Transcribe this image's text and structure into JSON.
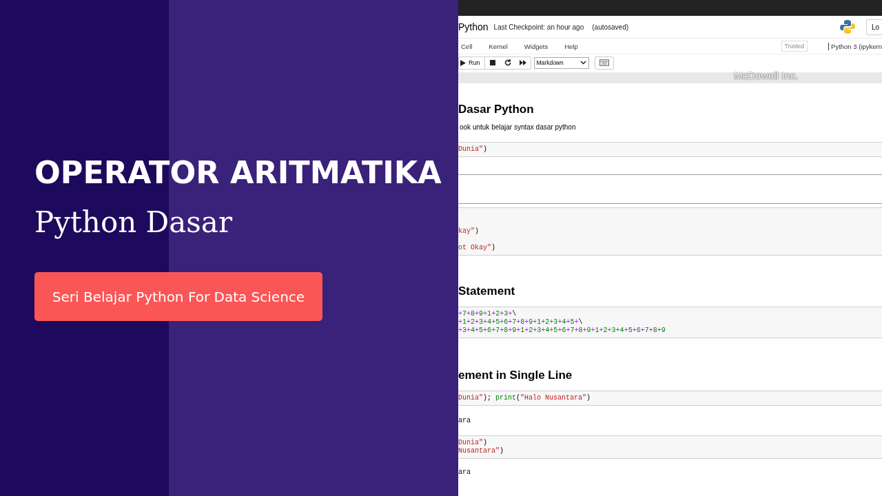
{
  "header": {
    "title": "Python",
    "checkpoint": "Last Checkpoint: an hour ago",
    "autosave": "(autosaved)",
    "login_button": "Lo"
  },
  "menu": [
    "Cell",
    "Kernel",
    "Widgets",
    "Help"
  ],
  "trusted": "Trusted",
  "kernel": "Python 3 (ipykern",
  "toolbar": {
    "run": "Run",
    "cell_type": "Markdown"
  },
  "brand_text": "McDowell Inc.",
  "cells": [
    {
      "kind": "heading",
      "selected": false,
      "text": "Dasar Python"
    },
    {
      "kind": "text",
      "selected": false,
      "text": "ook untuk belajar syntax dasar python"
    },
    {
      "kind": "code",
      "selected": false,
      "lines": [
        "Dunia\")"
      ]
    },
    {
      "kind": "markdown",
      "selected": true
    },
    {
      "kind": "code",
      "selected": false,
      "lines": [
        "kay\")",
        "ot Okay\")"
      ]
    },
    {
      "kind": "heading",
      "selected": false,
      "text": "Statement"
    },
    {
      "kind": "code",
      "selected": false,
      "lines": [
        "+7+8+9+1+2+3+\\",
        "+1+2+3+4+5+6+7+8+9+1+2+3+4+5+\\",
        "+3+4+5+6+7+8+9+1+2+3+4+5+6+7+8+9+1+2+3+4+5+6+7+8+9"
      ]
    },
    {
      "kind": "heading",
      "selected": false,
      "text": "ement in Single Line"
    },
    {
      "kind": "code",
      "selected": false,
      "lines": [
        "Dunia\"); print(\"Halo Nusantara\")"
      ]
    },
    {
      "kind": "output",
      "selected": false,
      "lines": [
        "ara"
      ]
    },
    {
      "kind": "code",
      "selected": false,
      "lines": [
        "Dunia\")",
        "Nusantara\")"
      ]
    },
    {
      "kind": "output",
      "selected": false,
      "lines": [
        "ara"
      ]
    }
  ],
  "banner": {
    "title": "OPERATOR ARITMATIKA",
    "subtitle": "Python Dasar",
    "button": "Seri Belajar Python For Data Science"
  }
}
